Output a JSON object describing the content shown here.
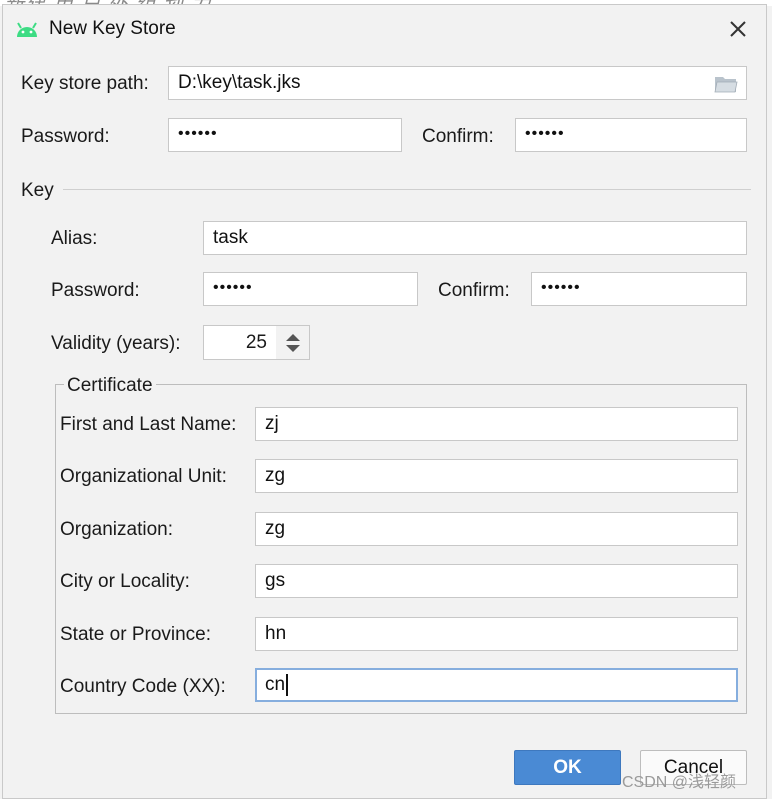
{
  "background": {
    "text": "新建 用 户 外 组 划 力"
  },
  "window": {
    "title": "New Key Store",
    "close_icon": "close-icon",
    "app_icon": "android-icon"
  },
  "keystore": {
    "path_label": "Key store path:",
    "path_value": "D:\\key\\task.jks",
    "folder_icon": "folder-icon",
    "password_label": "Password:",
    "password_value": "••••••",
    "confirm_label": "Confirm:",
    "confirm_value": "••••••"
  },
  "key": {
    "section_label": "Key",
    "alias_label": "Alias:",
    "alias_value": "task",
    "password_label": "Password:",
    "password_value": "••••••",
    "confirm_label": "Confirm:",
    "confirm_value": "••••••",
    "validity_label": "Validity (years):",
    "validity_value": "25"
  },
  "certificate": {
    "legend": "Certificate",
    "fields": [
      {
        "label": "First and Last Name:",
        "value": "zj"
      },
      {
        "label": "Organizational Unit:",
        "value": "zg"
      },
      {
        "label": "Organization:",
        "value": "zg"
      },
      {
        "label": "City or Locality:",
        "value": "gs"
      },
      {
        "label": "State or Province:",
        "value": "hn"
      },
      {
        "label": "Country Code (XX):",
        "value": "cn"
      }
    ]
  },
  "buttons": {
    "ok": "OK",
    "cancel": "Cancel"
  },
  "watermark": "CSDN @浅轻颜",
  "colors": {
    "accent": "#4a8ad4",
    "focus_border": "#86aede",
    "android_green": "#3ddc84"
  }
}
